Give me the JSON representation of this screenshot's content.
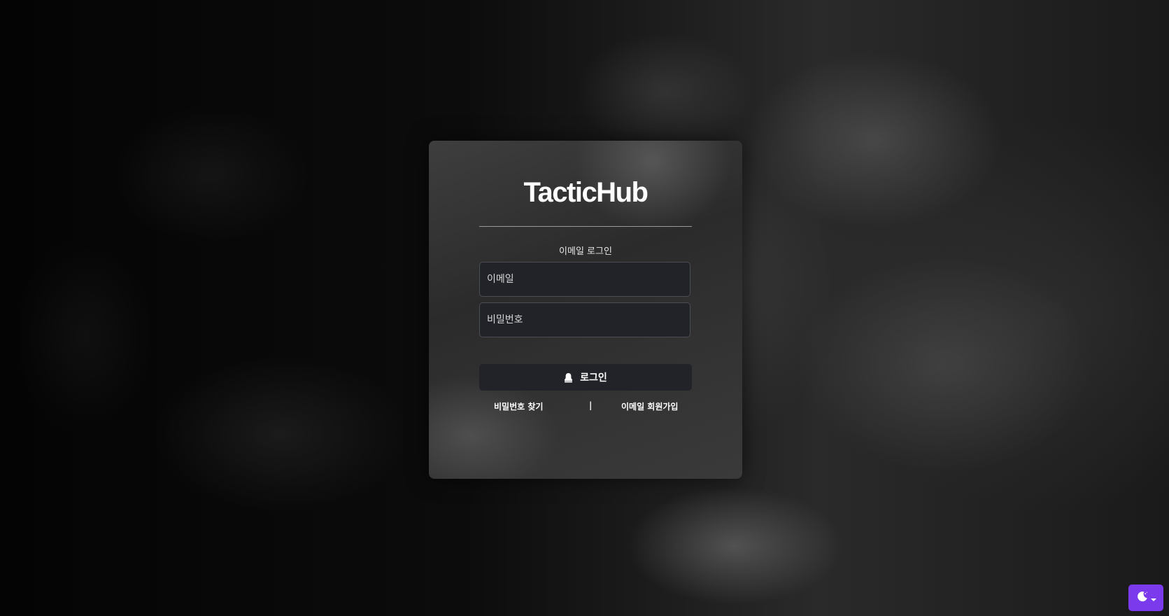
{
  "app": {
    "logo_text": "TacticHub"
  },
  "login": {
    "subtitle": "이메일 로그인",
    "email_placeholder": "이메일",
    "email_value": "",
    "password_placeholder": "비밀번호",
    "password_value": "",
    "submit_label": "로그인",
    "submit_icon": "user-icon",
    "find_password_label": "비밀번호 찾기",
    "separator": "|",
    "signup_label": "이메일 회원가입"
  },
  "theme_toggle": {
    "icon": "moon-icon",
    "dropdown_icon": "caret-down-icon",
    "accent_color": "#7c3aed"
  },
  "colors": {
    "card_bg": "#333333",
    "input_bg": "#212328",
    "button_bg": "#212328"
  }
}
